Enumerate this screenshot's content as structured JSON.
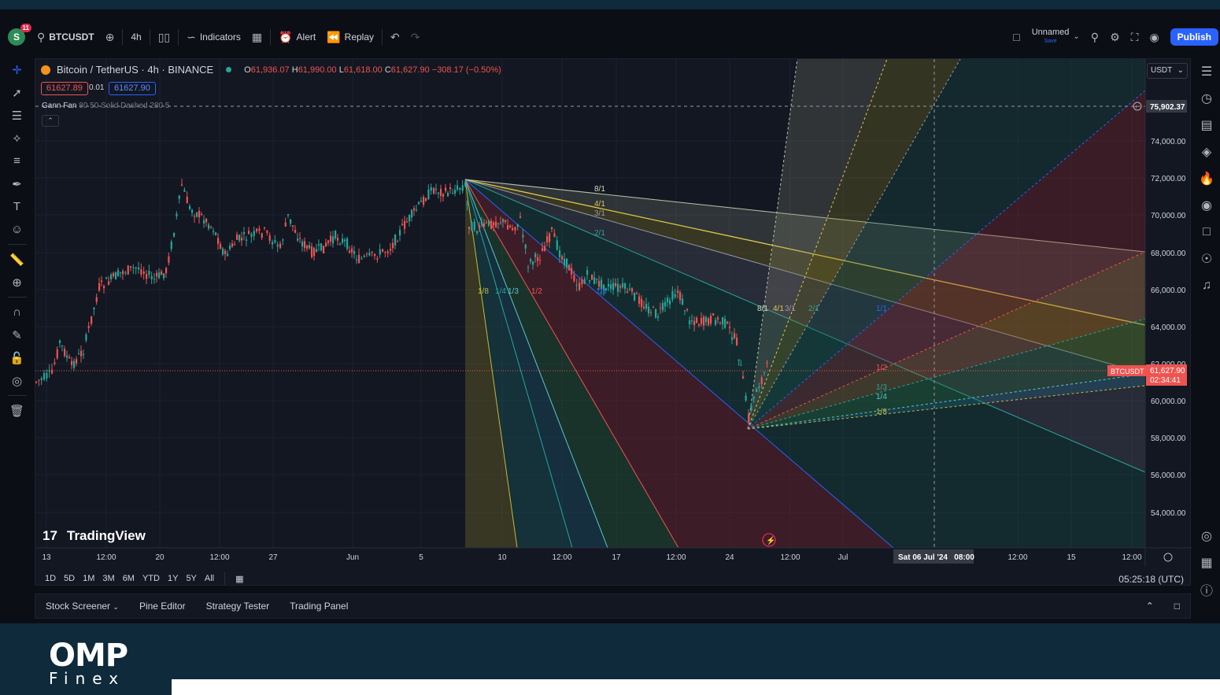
{
  "toolbar": {
    "notif_count": "11",
    "symbol": "BTCUSDT",
    "interval": "4h",
    "indicators": "Indicators",
    "alert": "Alert",
    "replay": "Replay",
    "layout_name": "Unnamed",
    "layout_save": "Save",
    "publish": "Publish"
  },
  "legend": {
    "title": "Bitcoin / TetherUS · 4h · BINANCE",
    "o_label": "O",
    "o": "61,936.07",
    "h_label": "H",
    "h": "61,990.00",
    "l_label": "L",
    "l": "61,618.00",
    "c_label": "C",
    "c": "61,627.90",
    "change": "−308.17 (−0.50%)",
    "sell": "61627.89",
    "spread": "0.01",
    "buy": "61627.90"
  },
  "study": {
    "name": "Gann Fan",
    "params": "80 50 Solid Dashed 280 5"
  },
  "yaxis": {
    "currency": "USDT",
    "ticks": [
      "74,000.00",
      "72,000.00",
      "70,000.00",
      "68,000.00",
      "66,000.00",
      "64,000.00",
      "62,000.00",
      "60,000.00",
      "58,000.00",
      "56,000.00",
      "54,000.00"
    ],
    "crosshair_price": "75,902.37",
    "last_symbol": "BTCUSDT",
    "last_price": "61,627.90",
    "countdown": "02:34:41"
  },
  "xaxis": {
    "ticks": [
      "13",
      "12:00",
      "20",
      "12:00",
      "27",
      "Jun",
      "5",
      "10",
      "12:00",
      "17",
      "12:00",
      "24",
      "12:00",
      "Jul",
      "12:00",
      "15",
      "12:00"
    ],
    "crosshair_time": "Sat 06 Jul '24   08:00"
  },
  "fan_labels": {
    "upper": [
      "8/1",
      "4/1",
      "3/1",
      "2/1"
    ],
    "lower": [
      "1/8",
      "1/4",
      "1/3",
      "1/2",
      "1/1"
    ],
    "up_right": [
      "8/1",
      "4/1",
      "3/1",
      "2/1",
      "1/1",
      "1/2",
      "1/3",
      "1/4",
      "1/8"
    ]
  },
  "watermark": "TradingView",
  "ranges": [
    "1D",
    "5D",
    "1M",
    "3M",
    "6M",
    "YTD",
    "1Y",
    "5Y",
    "All"
  ],
  "clock": "05:25:18 (UTC)",
  "panels": [
    "Stock Screener",
    "Pine Editor",
    "Strategy Tester",
    "Trading Panel"
  ],
  "brand": {
    "name": "OMP",
    "sub": "Finex"
  },
  "colors": {
    "up": "#26a69a",
    "down": "#ef5350",
    "accent": "#2962ff",
    "bg": "#131722"
  },
  "icons": {
    "left": [
      "crosshair-icon",
      "trend-line-icon",
      "fib-icon",
      "pattern-icon",
      "forecast-icon",
      "brush-icon",
      "text-icon",
      "emoji-icon",
      "ruler-icon",
      "zoom-icon",
      "magnet-icon",
      "lock-drawing-icon",
      "lock-icon",
      "eye-icon",
      "trash-icon"
    ],
    "right": [
      "watchlist-icon",
      "alerts-icon",
      "news-icon",
      "layers-icon",
      "hotlist-icon",
      "ideas-icon",
      "chat-icon",
      "streams-icon",
      "notifications-icon",
      "target-icon",
      "calendar-icon",
      "help-icon"
    ]
  }
}
